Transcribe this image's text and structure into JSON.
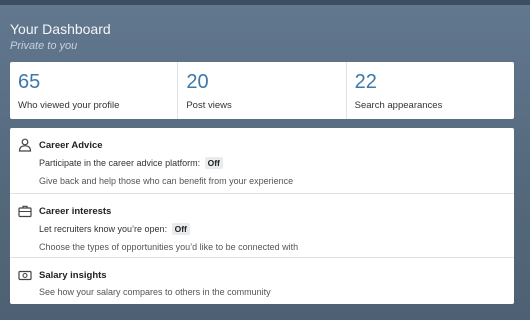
{
  "dashboard": {
    "title": "Your Dashboard",
    "subtitle": "Private to you"
  },
  "stats": [
    {
      "value": "65",
      "label": "Who viewed your profile"
    },
    {
      "value": "20",
      "label": "Post views"
    },
    {
      "value": "22",
      "label": "Search appearances"
    }
  ],
  "sections": {
    "career_advice": {
      "icon": "person-icon",
      "title": "Career Advice",
      "line1": "Participate in the career advice platform:",
      "badge": "Off",
      "line2": "Give back and help those who can benefit from your experience"
    },
    "career_interests": {
      "icon": "briefcase-icon",
      "title": "Career interests",
      "line1": "Let recruiters know you’re open:",
      "badge": "Off",
      "line2": "Choose the types of opportunities you’d like to be connected with"
    },
    "salary_insights": {
      "icon": "salary-icon",
      "title": "Salary insights",
      "line1": "See how your salary compares to others in the community"
    }
  },
  "colors": {
    "accent": "#3c78aa",
    "background": "#5c7188"
  }
}
